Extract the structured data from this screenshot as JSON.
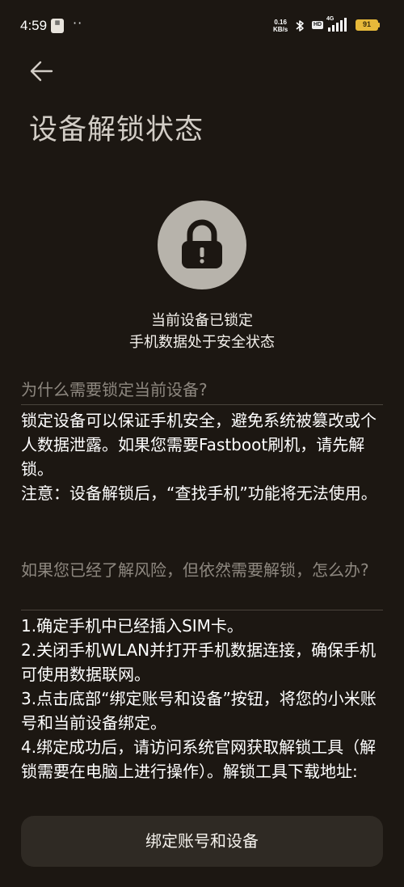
{
  "status_bar": {
    "time": "4:59",
    "notification_icon": "calendar-icon",
    "more_indicator": "··",
    "net_speed_value": "0.16",
    "net_speed_unit": "KB/s",
    "hd_badge": "HD",
    "network_type": "4G",
    "battery_level": "91",
    "battery_color": "#e7b93a"
  },
  "header": {
    "back_icon": "back-arrow-icon",
    "title": "设备解锁状态"
  },
  "lock_status": {
    "icon": "lock-icon",
    "line1": "当前设备已锁定",
    "line2": "手机数据处于安全状态"
  },
  "section1": {
    "title": "为什么需要锁定当前设备?",
    "paragraphs": [
      "锁定设备可以保证手机安全，避免系统被篡改或个人数据泄露。如果您需要Fastboot刷机，请先解锁。",
      "注意：设备解锁后，“查找手机”功能将无法使用。"
    ]
  },
  "section2": {
    "title": "如果您已经了解风险，但依然需要解锁，怎么办?",
    "steps": [
      "1.确定手机中已经插入SIM卡。",
      "2.关闭手机WLAN并打开手机数据连接，确保手机可使用数据联网。",
      "3.点击底部“绑定账号和设备”按钮，将您的小米账号和当前设备绑定。",
      "4.绑定成功后，请访问系统官网获取解锁工具（解锁需要在电脑上进行操作）。解锁工具下载地址:"
    ]
  },
  "bind_button": {
    "label": "绑定账号和设备"
  },
  "colors": {
    "background": "#1c1712",
    "section_title": "#8d877f",
    "button_bg": "#2f2a24",
    "lock_circle": "#b7b3ab"
  }
}
